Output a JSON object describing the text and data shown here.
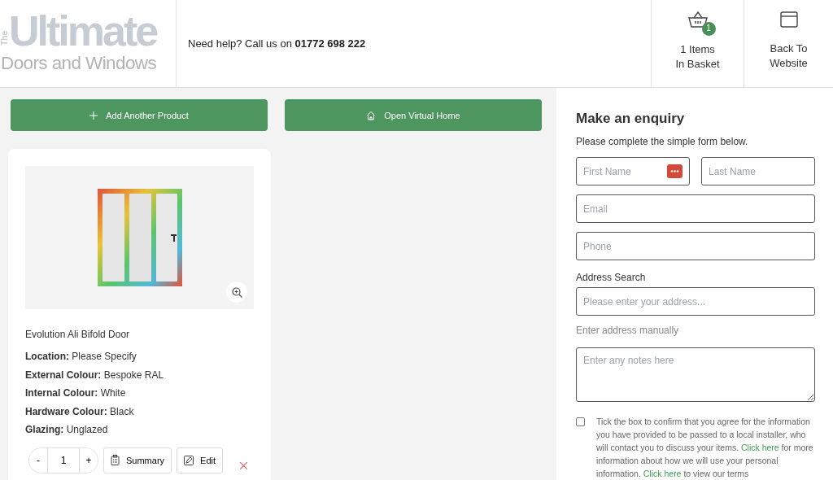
{
  "header": {
    "logo": {
      "the": "The",
      "main": "Ultimate",
      "sub": "Doors and Windows"
    },
    "help_text": "Need help? Call us on ",
    "phone": "01772 698 222",
    "basket": {
      "count": "1",
      "line1": "1 Items",
      "line2": "In Basket"
    },
    "back": {
      "line1": "Back To",
      "line2": "Website"
    }
  },
  "actions": [
    {
      "kind": "add",
      "label": "Add Another Product"
    },
    {
      "kind": "home",
      "label": "Open Virtual Home"
    }
  ],
  "product": {
    "name": "Evolution Ali Bifold Door",
    "specs": [
      {
        "label": "Location:",
        "value": "Please Specify"
      },
      {
        "label": "External Colour:",
        "value": "Bespoke RAL"
      },
      {
        "label": "Internal Colour:",
        "value": "White"
      },
      {
        "label": "Hardware Colour:",
        "value": "Black"
      },
      {
        "label": "Glazing:",
        "value": "Unglazed"
      }
    ],
    "quantity": {
      "minus": "-",
      "value": "1",
      "plus": "+"
    },
    "buttons": [
      {
        "kind": "summary",
        "label": "Summary"
      },
      {
        "kind": "edit",
        "label": "Edit"
      }
    ]
  },
  "enquiry": {
    "title": "Make an enquiry",
    "subtitle": "Please complete the simple form below.",
    "first_name": {
      "placeholder": "First Name"
    },
    "last_name": {
      "placeholder": "Last Name"
    },
    "email": {
      "placeholder": "Email"
    },
    "phone": {
      "placeholder": "Phone"
    },
    "address_label": "Address Search",
    "address": {
      "placeholder": "Please enter your address..."
    },
    "manual_link": "Enter address manually",
    "notes": {
      "placeholder": "Enter any notes here"
    },
    "consent": {
      "checked": false,
      "parts": [
        {
          "kind": "text",
          "text": "Tick the box to confirm that you agree for the information you have provided to be passed to a local installer, who will contact you to discuss your items. "
        },
        {
          "kind": "link",
          "text": "Click here"
        },
        {
          "kind": "text",
          "text": " for more information about how we will use your personal information. "
        },
        {
          "kind": "link",
          "text": "Click here"
        },
        {
          "kind": "text",
          "text": " to view our terms"
        }
      ]
    }
  }
}
